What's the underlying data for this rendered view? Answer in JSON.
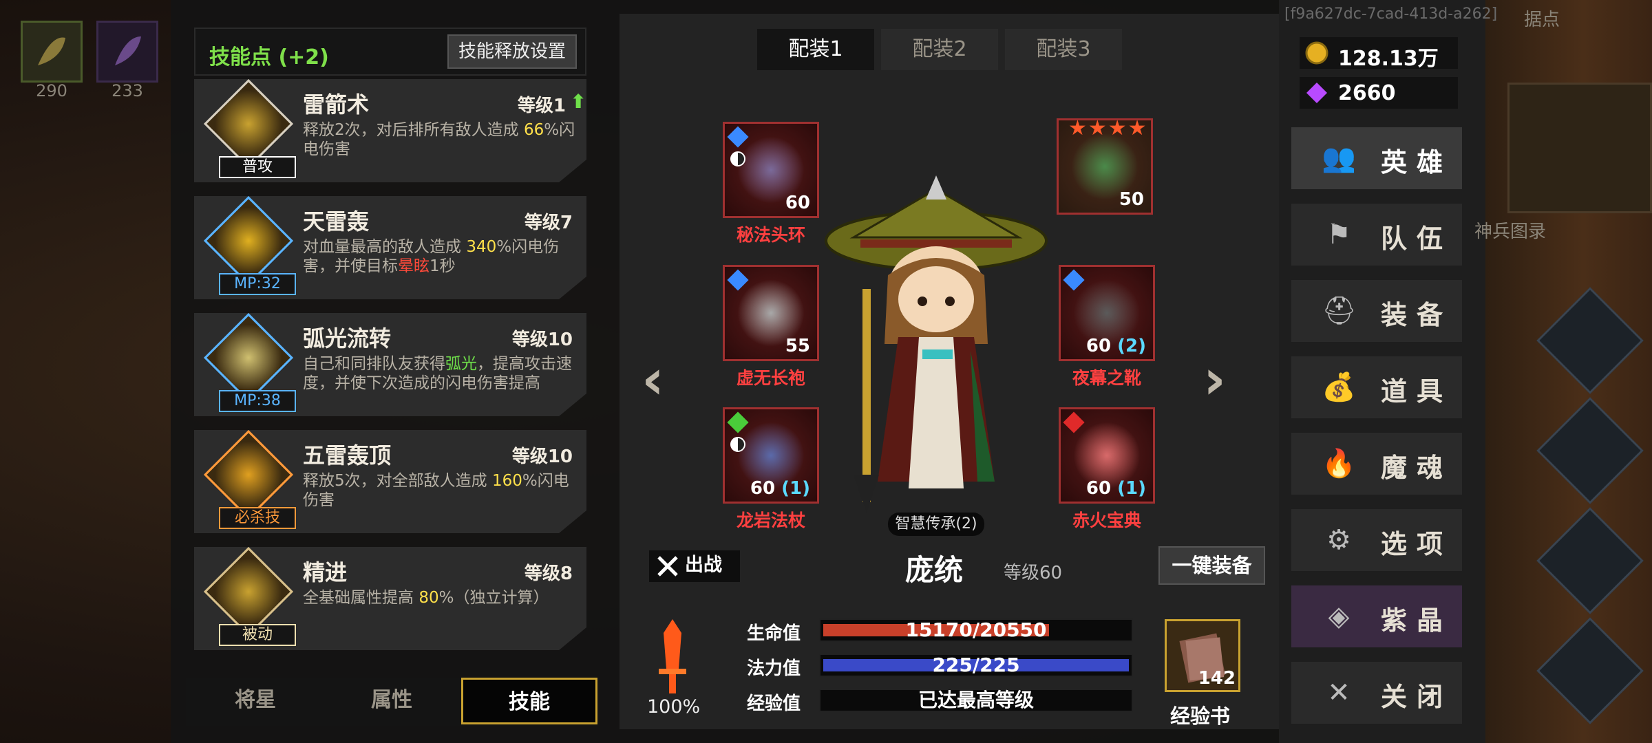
{
  "top": {
    "id_text": "[f9a627dc-7cad-413d-a262]",
    "base_label": "据点",
    "map_label": "神兵图录",
    "resources_left": [
      {
        "icon": "leaf-item-icon",
        "count": "290"
      },
      {
        "icon": "feather-item-icon",
        "count": "233"
      }
    ]
  },
  "skills_panel": {
    "header_title": "技能点 (+2)",
    "release_settings_button": "技能释放设置",
    "skills": [
      {
        "name": "雷箭术",
        "level": "等级1",
        "tag": "普攻",
        "tag_color": "#ffffff",
        "desc_parts": [
          [
            "释放2次，对后排所有敌人造成 ",
            ""
          ],
          [
            "66",
            "y"
          ],
          [
            "%闪电伤害",
            ""
          ]
        ]
      },
      {
        "name": "天雷轰",
        "level": "等级7",
        "tag": "MP:32",
        "tag_color": "#5ab4ff",
        "desc_parts": [
          [
            "对血量最高的敌人造成 ",
            ""
          ],
          [
            "340",
            "y"
          ],
          [
            "%闪电伤害，并使目标",
            ""
          ],
          [
            "晕眩",
            "r"
          ],
          [
            "1秒",
            ""
          ]
        ]
      },
      {
        "name": "弧光流转",
        "level": "等级10",
        "tag": "MP:38",
        "tag_color": "#5ab4ff",
        "desc_parts": [
          [
            "自己和同排队友获得",
            ""
          ],
          [
            "弧光",
            "g"
          ],
          [
            "，提高攻击速度，并使下次造成的闪电伤害提高",
            ""
          ]
        ]
      },
      {
        "name": "五雷轰顶",
        "level": "等级10",
        "tag": "必杀技",
        "tag_color": "#ff9a3a",
        "desc_parts": [
          [
            "释放5次，对全部敌人造成 ",
            ""
          ],
          [
            "160",
            "y"
          ],
          [
            "%闪电伤害",
            ""
          ]
        ]
      },
      {
        "name": "精进",
        "level": "等级8",
        "tag": "被动",
        "tag_color": "#f0e0b0",
        "desc_parts": [
          [
            "全基础属性提高 ",
            ""
          ],
          [
            "80",
            "y"
          ],
          [
            "%（独立计算）",
            ""
          ]
        ]
      }
    ],
    "bottom_tabs": [
      "将星",
      "属性",
      "技能"
    ],
    "active_bottom_tab": 2
  },
  "center": {
    "loadout_tabs": [
      "配装1",
      "配装2",
      "配装3"
    ],
    "active_loadout": 0,
    "equipment": [
      {
        "slot": "head",
        "name": "秘法头环",
        "level": "60",
        "plus": "",
        "gem": "#3a8aff",
        "yinyang": true
      },
      {
        "slot": "pet",
        "name": "",
        "level": "50",
        "plus": "",
        "gem": "",
        "yinyang": false,
        "stars": 4
      },
      {
        "slot": "body",
        "name": "虚无长袍",
        "level": "55",
        "plus": "",
        "gem": "#3a8aff",
        "yinyang": false
      },
      {
        "slot": "boots",
        "name": "夜幕之靴",
        "level": "60",
        "plus": "(2)",
        "gem": "#3a8aff",
        "yinyang": false
      },
      {
        "slot": "weapon",
        "name": "龙岩法杖",
        "level": "60",
        "plus": "(1)",
        "gem": "#4acc3a",
        "yinyang": true
      },
      {
        "slot": "book",
        "name": "赤火宝典",
        "level": "60",
        "plus": "(1)",
        "gem": "#e02a2a",
        "yinyang": false
      }
    ],
    "legacy_badge": "智慧传承(2)",
    "sortie_label": "出战",
    "hero_name": "庞统",
    "hero_level": "等级60",
    "one_click_equip": "一键装备",
    "stats": {
      "hp_label": "生命值",
      "hp_text": "15170/20550",
      "hp_current": 15170,
      "hp_max": 20550,
      "mp_label": "法力值",
      "mp_text": "225/225",
      "mp_current": 225,
      "mp_max": 225,
      "exp_label": "经验值",
      "exp_text": "已达最高等级"
    },
    "attack_percent": "100%",
    "exp_book": {
      "label": "经验书",
      "count": "142"
    }
  },
  "right_menu": {
    "gold": "128.13万",
    "gems": "2660",
    "items": [
      {
        "label": "英雄",
        "icon": "hero-icon"
      },
      {
        "label": "队伍",
        "icon": "flag-icon"
      },
      {
        "label": "装备",
        "icon": "helmet-icon"
      },
      {
        "label": "道具",
        "icon": "bag-icon"
      },
      {
        "label": "魔魂",
        "icon": "flame-icon"
      },
      {
        "label": "选项",
        "icon": "gear-icon"
      },
      {
        "label": "紫晶",
        "icon": "crystal-icon"
      },
      {
        "label": "关闭",
        "icon": "close-icon"
      }
    ],
    "active_item": 0,
    "colors": {
      "gold": "#e6b022",
      "gem": "#b84aff",
      "accent": "#c9a230"
    }
  }
}
